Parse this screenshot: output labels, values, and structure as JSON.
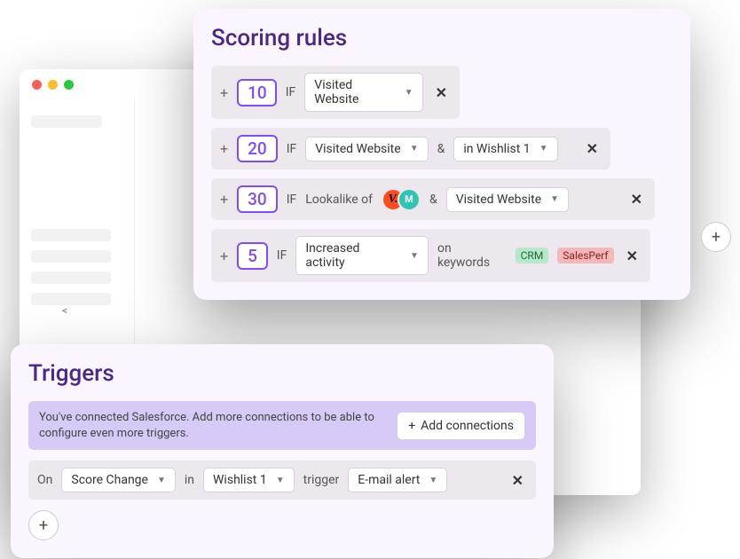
{
  "scoring": {
    "title": "Scoring rules",
    "rules": [
      {
        "score": "10",
        "if_label": "IF",
        "conds": [
          {
            "type": "dd",
            "label": "Visited Website"
          }
        ]
      },
      {
        "score": "20",
        "if_label": "IF",
        "conds": [
          {
            "type": "dd",
            "label": "Visited Website"
          },
          {
            "type": "amp",
            "label": "&"
          },
          {
            "type": "dd",
            "label": "in Wishlist 1"
          }
        ]
      },
      {
        "score": "30",
        "if_label": "IF",
        "lookalike_label": "Lookalike of",
        "avatars": [
          "V.",
          "M"
        ],
        "conds_amp": "&",
        "cond2": "Visited Website"
      },
      {
        "score": "5",
        "if_label": "IF",
        "cond": "Increased activity",
        "on_keywords_label": "on keywords",
        "tags": [
          "CRM",
          "SalesPerf"
        ]
      }
    ],
    "plus_literal": "+",
    "add_button": "+"
  },
  "triggers": {
    "title": "Triggers",
    "banner_text": "You've connected Salesforce. Add more connections to be able to configure even more triggers.",
    "banner_btn_plus": "+",
    "banner_btn_label": "Add connections",
    "row": {
      "on": "On",
      "select1": "Score Change",
      "in": "in",
      "select2": "Wishlist 1",
      "trigger": "trigger",
      "select3": "E-mail alert"
    },
    "add_button": "+"
  },
  "bg": {
    "chevron": "<"
  }
}
